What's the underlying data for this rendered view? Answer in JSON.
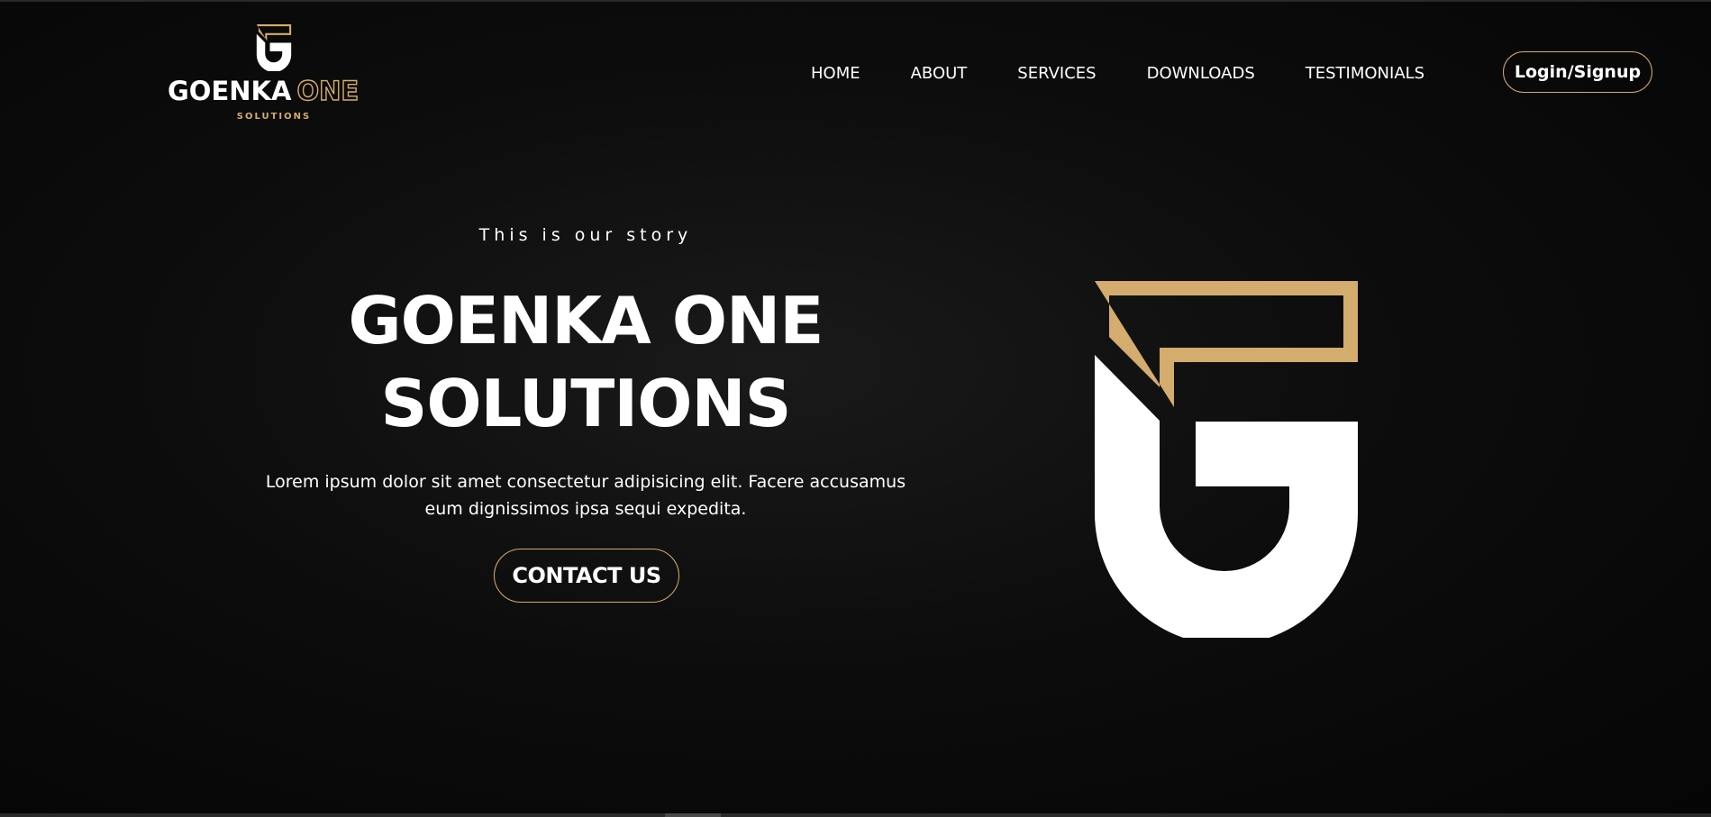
{
  "brand": {
    "name_part1": "GOENKA",
    "name_part2": "ONE",
    "subtitle": "SOLUTIONS",
    "logo_icon": "goenka-g-monogram-icon"
  },
  "nav": {
    "items": [
      {
        "label": "HOME"
      },
      {
        "label": "ABOUT"
      },
      {
        "label": "SERVICES"
      },
      {
        "label": "DOWNLOADS"
      },
      {
        "label": "TESTIMONIALS"
      }
    ],
    "login_label": "Login/Signup"
  },
  "hero": {
    "eyebrow": "This is our story",
    "title_line1": "GOENKA ONE",
    "title_line2": "SOLUTIONS",
    "description": "Lorem ipsum dolor sit amet consectetur adipisicing elit. Facere accusamus eum dignissimos ipsa sequi expedita.",
    "cta_label": "CONTACT US",
    "illustration_icon": "goenka-g-monogram-icon"
  },
  "colors": {
    "background": "#0a0a0a",
    "accent_gold": "#d4ac6e",
    "text": "#ffffff"
  }
}
